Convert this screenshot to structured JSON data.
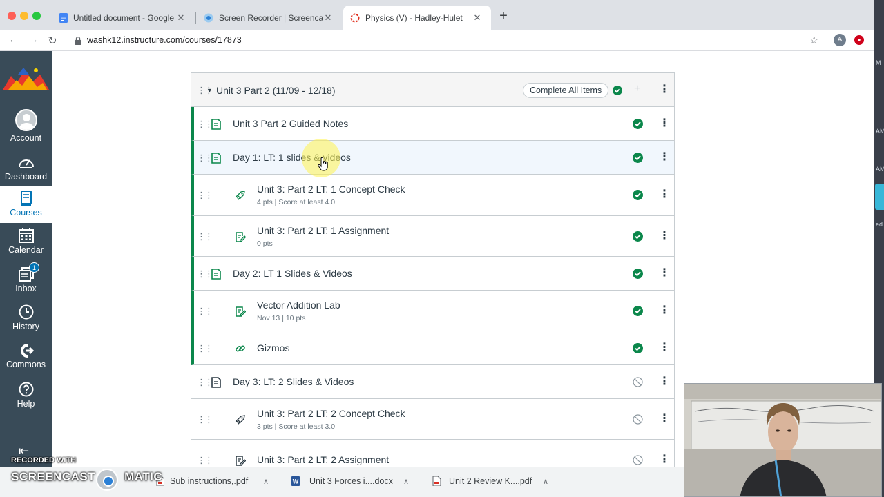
{
  "browser": {
    "tabs": [
      {
        "title": "Untitled document - Google Do",
        "icon": "google-docs-icon"
      },
      {
        "title": "Screen Recorder | Screencast-",
        "icon": "screencast-icon"
      },
      {
        "title": "Physics (V) - Hadley-Hulet",
        "icon": "canvas-icon",
        "active": true
      }
    ],
    "url": "washk12.instructure.com/courses/17873",
    "profile_initial": "A"
  },
  "right_edge_text": [
    "M",
    "AM",
    "AM",
    "ed"
  ],
  "global_nav": {
    "items": [
      {
        "label": "Account",
        "icon": "user-avatar-icon"
      },
      {
        "label": "Dashboard",
        "icon": "dashboard-icon"
      },
      {
        "label": "Courses",
        "icon": "courses-icon",
        "active": true
      },
      {
        "label": "Calendar",
        "icon": "calendar-icon"
      },
      {
        "label": "Inbox",
        "icon": "inbox-icon",
        "badge": "1"
      },
      {
        "label": "History",
        "icon": "clock-icon"
      },
      {
        "label": "Commons",
        "icon": "commons-icon"
      },
      {
        "label": "Help",
        "icon": "help-icon"
      }
    ]
  },
  "module": {
    "title": "Unit 3 Part 2 (11/09 - 12/18)",
    "complete_all_label": "Complete All Items",
    "items": [
      {
        "title": "Unit 3 Part 2 Guided Notes",
        "type": "page",
        "indent": false,
        "completed": true,
        "details": []
      },
      {
        "title": "Day 1: LT: 1 slides & videos",
        "type": "page",
        "indent": false,
        "completed": true,
        "details": []
      },
      {
        "title": "Unit 3: Part 2 LT: 1 Concept Check",
        "type": "quiz",
        "indent": true,
        "completed": true,
        "details": [
          "4 pts",
          "Score at least 4.0"
        ]
      },
      {
        "title": "Unit 3: Part 2 LT: 1 Assignment",
        "type": "assignment",
        "indent": true,
        "completed": true,
        "details": [
          "0 pts"
        ]
      },
      {
        "title": "Day 2: LT 1 Slides & Videos",
        "type": "page",
        "indent": false,
        "completed": true,
        "details": []
      },
      {
        "title": "Vector Addition Lab",
        "type": "assignment",
        "indent": true,
        "completed": true,
        "details": [
          "Nov 13",
          "10 pts"
        ]
      },
      {
        "title": "Gizmos",
        "type": "link",
        "indent": true,
        "completed": true,
        "details": []
      },
      {
        "title": "Day 3: LT: 2 Slides & Videos",
        "type": "page",
        "indent": false,
        "completed": false,
        "details": []
      },
      {
        "title": "Unit 3: Part 2 LT: 2 Concept Check",
        "type": "quiz",
        "indent": true,
        "completed": false,
        "details": [
          "3 pts",
          "Score at least 3.0"
        ]
      },
      {
        "title": "Unit 3: Part 2 LT: 2 Assignment",
        "type": "assignment",
        "indent": true,
        "completed": false,
        "details": []
      }
    ]
  },
  "downloads": [
    {
      "name": "Sub instructions,.pdf",
      "icon": "pdf-icon"
    },
    {
      "name": "Unit 3 Forces i....docx",
      "icon": "word-icon"
    },
    {
      "name": "Unit 2 Review K....pdf",
      "icon": "pdf-icon"
    }
  ],
  "watermark": {
    "line1": "RECORDED WITH",
    "line2a": "SCREENCAST",
    "line2b": "MATIC"
  },
  "colors": {
    "nav_bg": "#394b58",
    "accent": "#0374b5",
    "success": "#0b874b",
    "page_icon": "#0b874b"
  }
}
